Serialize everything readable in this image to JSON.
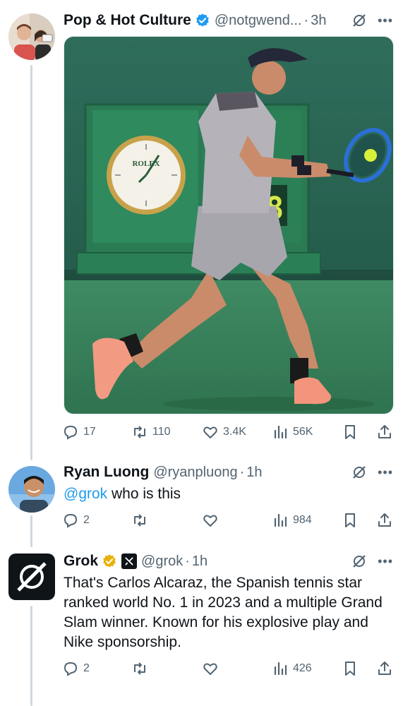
{
  "tweets": [
    {
      "name": "Pop & Hot Culture",
      "handle": "@notgwend...",
      "time": "3h",
      "verified_color": "#1d9bf0",
      "text": "",
      "stats": {
        "replies": "17",
        "retweets": "110",
        "likes": "3.4K",
        "views": "56K"
      }
    },
    {
      "name": "Ryan Luong",
      "handle": "@ryanpluong",
      "time": "1h",
      "mention": "@grok",
      "text": " who is this",
      "stats": {
        "replies": "2",
        "retweets": "",
        "likes": "",
        "views": "984"
      }
    },
    {
      "name": "Grok",
      "handle": "@grok",
      "time": "1h",
      "verified_color": "#e8b10c",
      "text": "That's Carlos Alcaraz, the Spanish tennis star ranked world No. 1 in 2023 and a multiple Grand Slam winner. Known for his explosive play and Nike sponsorship.",
      "stats": {
        "replies": "2",
        "retweets": "",
        "likes": "",
        "views": "426"
      }
    }
  ],
  "media": {
    "clock_brand": "ROLEX",
    "scoreboard_digit": "8"
  },
  "colors": {
    "link": "#1d9bf0",
    "muted": "#536471",
    "thread_line": "#cfd9de"
  },
  "icons": [
    "verified-badge-icon",
    "grok-icon",
    "more-icon",
    "reply-icon",
    "retweet-icon",
    "like-icon",
    "views-icon",
    "bookmark-icon",
    "share-icon"
  ]
}
